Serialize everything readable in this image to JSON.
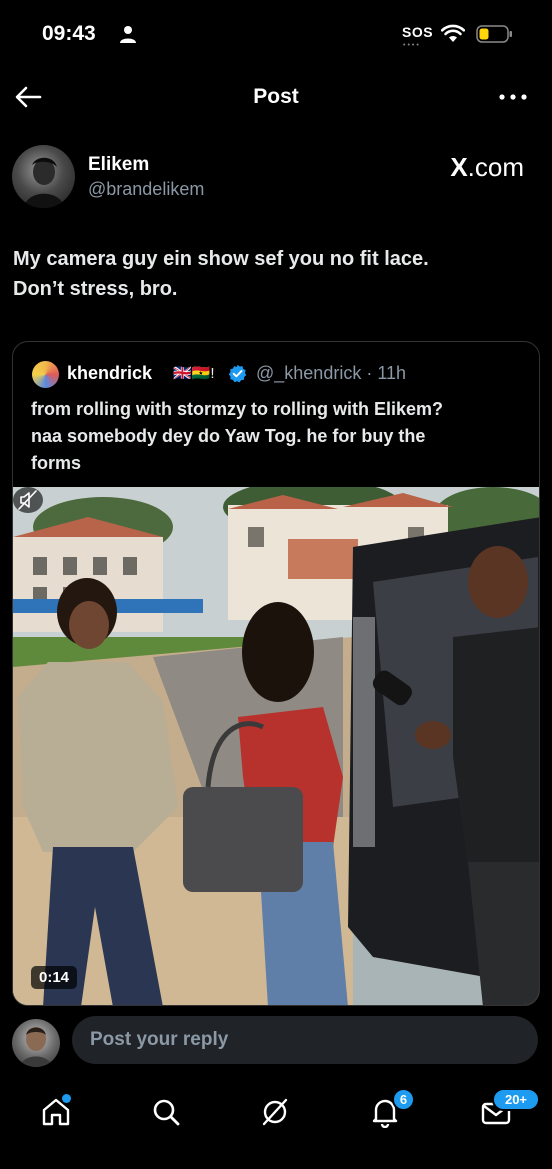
{
  "status_bar": {
    "time": "09:43",
    "carrier_status": "SOS",
    "icons": [
      "person-icon",
      "wifi-icon",
      "battery-icon"
    ]
  },
  "nav": {
    "title": "Post",
    "back_icon": "arrow-left-icon",
    "more_icon": "more-horizontal-icon"
  },
  "author": {
    "name": "Elikem",
    "handle": "@brandelikem",
    "source_prefix": "X",
    "source_suffix": ".com"
  },
  "post": {
    "text_line1": "My camera guy ein show sef you no fit lace.",
    "text_line2": "Don’t stress, bro."
  },
  "quote": {
    "name": "khendrick",
    "flags": "🇬🇧🇬🇭!",
    "handle_time": "@_khendrick · 11h",
    "text_line1": "from rolling with stormzy to rolling with Elikem?",
    "text_line2": "naa somebody dey do Yaw Tog. he for buy the",
    "text_line3": "forms",
    "video": {
      "duration": "0:14",
      "muted_icon": "volume-muted-icon"
    }
  },
  "reply": {
    "placeholder": "Post your reply"
  },
  "tabbar": {
    "items": [
      {
        "name": "home",
        "icon": "home-icon"
      },
      {
        "name": "search",
        "icon": "search-icon"
      },
      {
        "name": "grok",
        "icon": "grok-icon"
      },
      {
        "name": "notifications",
        "icon": "bell-icon",
        "badge": "6"
      },
      {
        "name": "messages",
        "icon": "mail-icon",
        "badge": "20+"
      }
    ]
  },
  "colors": {
    "background": "#000000",
    "accent": "#1d9bf0",
    "secondary_text": "#8b98a5"
  }
}
